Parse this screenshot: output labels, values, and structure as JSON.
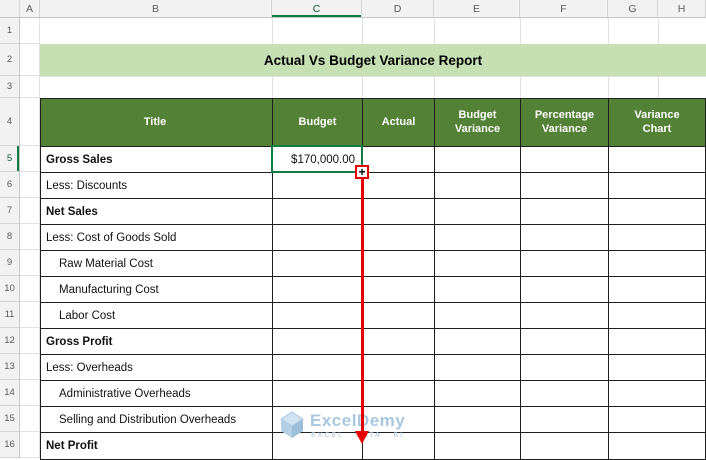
{
  "grid": {
    "columns": [
      "A",
      "B",
      "C",
      "D",
      "E",
      "F",
      "G",
      "H"
    ],
    "rows": [
      "1",
      "2",
      "3",
      "4",
      "5",
      "6",
      "7",
      "8",
      "9",
      "10",
      "11",
      "12",
      "13",
      "14",
      "15",
      "16"
    ]
  },
  "banner": {
    "title": "Actual Vs Budget Variance Report"
  },
  "report_table": {
    "columns": {
      "title": "Title",
      "budget": "Budget",
      "actual": "Actual",
      "budget_variance": "Budget Variance",
      "percentage_variance": "Percentage Variance",
      "variance_chart": "Variance Chart"
    },
    "rows": [
      {
        "title": "Gross Sales",
        "budget": "$170,000.00"
      },
      {
        "title": "Less: Discounts",
        "budget": ""
      },
      {
        "title": "Net Sales",
        "budget": ""
      },
      {
        "title": "Less: Cost of Goods Sold",
        "budget": ""
      },
      {
        "title": "Raw Material Cost",
        "budget": ""
      },
      {
        "title": "Manufacturing Cost",
        "budget": ""
      },
      {
        "title": "Labor Cost",
        "budget": ""
      },
      {
        "title": "Gross Profit",
        "budget": ""
      },
      {
        "title": "Less: Overheads",
        "budget": ""
      },
      {
        "title": "Administrative Overheads",
        "budget": ""
      },
      {
        "title": "Selling and Distribution Overheads",
        "budget": ""
      },
      {
        "title": "Net Profit",
        "budget": ""
      }
    ]
  },
  "selection": {
    "cell": "C5",
    "value": "$170,000.00"
  },
  "annotations": {
    "plus_glyph": "+"
  },
  "watermark": {
    "brand": "ExcelDemy",
    "tagline": "EXCEL · DATA · BI"
  },
  "colors": {
    "banner_green": "#C6E0B4",
    "header_green": "#538135",
    "selection_green": "#107C41",
    "annotation_red": "#E60000",
    "watermark_blue": "#A9C8DF"
  }
}
